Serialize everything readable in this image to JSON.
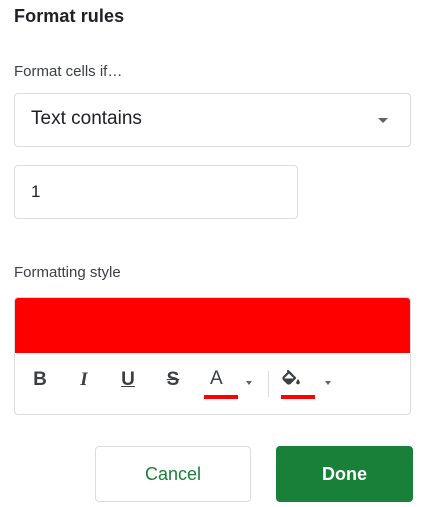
{
  "format_rules": {
    "title": "Format rules",
    "condition_label": "Format cells if…",
    "condition": {
      "selected": "Text contains"
    },
    "value_input": {
      "value": "1"
    }
  },
  "formatting_style": {
    "label": "Formatting style",
    "preview_fill_color": "#ff0000",
    "toolbar": {
      "bold": "B",
      "italic": "I",
      "underline": "U",
      "strikethrough": "S",
      "text_color_glyph": "A",
      "text_color": "#ff0000",
      "fill_color": "#ff0000",
      "icons": {
        "text_color": "text-color-icon",
        "fill_color": "fill-color-bucket-icon"
      }
    }
  },
  "actions": {
    "cancel_label": "Cancel",
    "done_label": "Done",
    "accent_color": "#188038"
  }
}
